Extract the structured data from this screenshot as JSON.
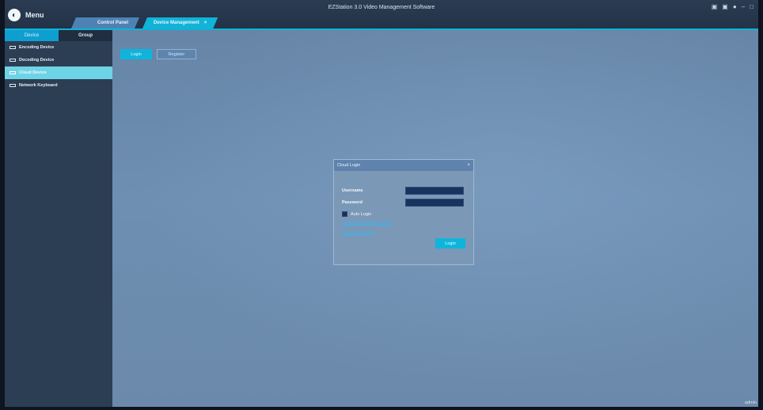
{
  "window": {
    "title": "EZStation 3.0 Video Management Software",
    "menu_label": "Menu",
    "controls": [
      "▣",
      "▣",
      "●",
      "–",
      "□"
    ]
  },
  "tabs": [
    {
      "label": "Control Panel"
    },
    {
      "label": "Device Management",
      "close": "×"
    }
  ],
  "sidebar": {
    "tabs": [
      {
        "label": "Device"
      },
      {
        "label": "Group"
      }
    ],
    "items": [
      {
        "label": "Encoding Device"
      },
      {
        "label": "Decoding Device"
      },
      {
        "label": "Cloud Device"
      },
      {
        "label": "Network Keyboard"
      }
    ]
  },
  "toolbar": {
    "login_label": "Login",
    "register_label": "Register"
  },
  "dialog": {
    "title": "Cloud Login",
    "close": "×",
    "username_label": "Username",
    "password_label": "Password",
    "auto_login_label": "Auto Login",
    "link1": "Login With Verification Code",
    "link2": "Forgot Password?",
    "login_button": "Login"
  },
  "status": {
    "user": "admin"
  }
}
